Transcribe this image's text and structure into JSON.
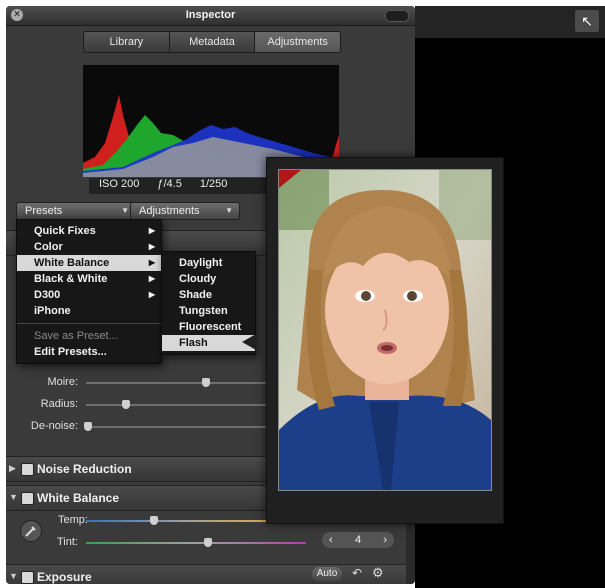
{
  "window": {
    "title": "Inspector"
  },
  "tabs": [
    "Library",
    "Metadata",
    "Adjustments"
  ],
  "active_tab": "Adjustments",
  "exif": {
    "iso": "ISO 200",
    "aperture": "ƒ/4.5",
    "shutter": "1/250"
  },
  "buttons": {
    "presets": "Presets",
    "adjustments": "Adjustments",
    "auto": "Auto"
  },
  "presets_menu": {
    "items": [
      {
        "label": "Quick Fixes",
        "submenu": true
      },
      {
        "label": "Color",
        "submenu": true
      },
      {
        "label": "White Balance",
        "submenu": true,
        "selected": true
      },
      {
        "label": "Black & White",
        "submenu": true
      },
      {
        "label": "D300",
        "submenu": true
      },
      {
        "label": "iPhone",
        "submenu": false
      }
    ],
    "save_preset": "Save as Preset...",
    "edit_presets": "Edit Presets..."
  },
  "white_balance_submenu": [
    "Daylight",
    "Cloudy",
    "Shade",
    "Tungsten",
    "Fluorescent",
    "Flash"
  ],
  "white_balance_selected": "Flash",
  "sharpen_sliders": [
    {
      "label": "Moire:",
      "value": 0.6
    },
    {
      "label": "Radius:",
      "value": 0.2
    },
    {
      "label": "De-noise:",
      "value": 0.0
    }
  ],
  "sections": {
    "noise_reduction": "Noise Reduction",
    "white_balance": "White Balance",
    "exposure": "Exposure"
  },
  "white_balance_controls": {
    "temp_label": "Temp:",
    "temp_value": 0.35,
    "tint_label": "Tint:",
    "tint_value": 0.55,
    "tint_number": "4"
  },
  "colors": {
    "panel": "#3a3a3a",
    "histogram_red": "#d0201e",
    "histogram_green": "#1fa62c",
    "histogram_blue": "#1d35c8",
    "jacket_blue": "#1d3f8a"
  }
}
